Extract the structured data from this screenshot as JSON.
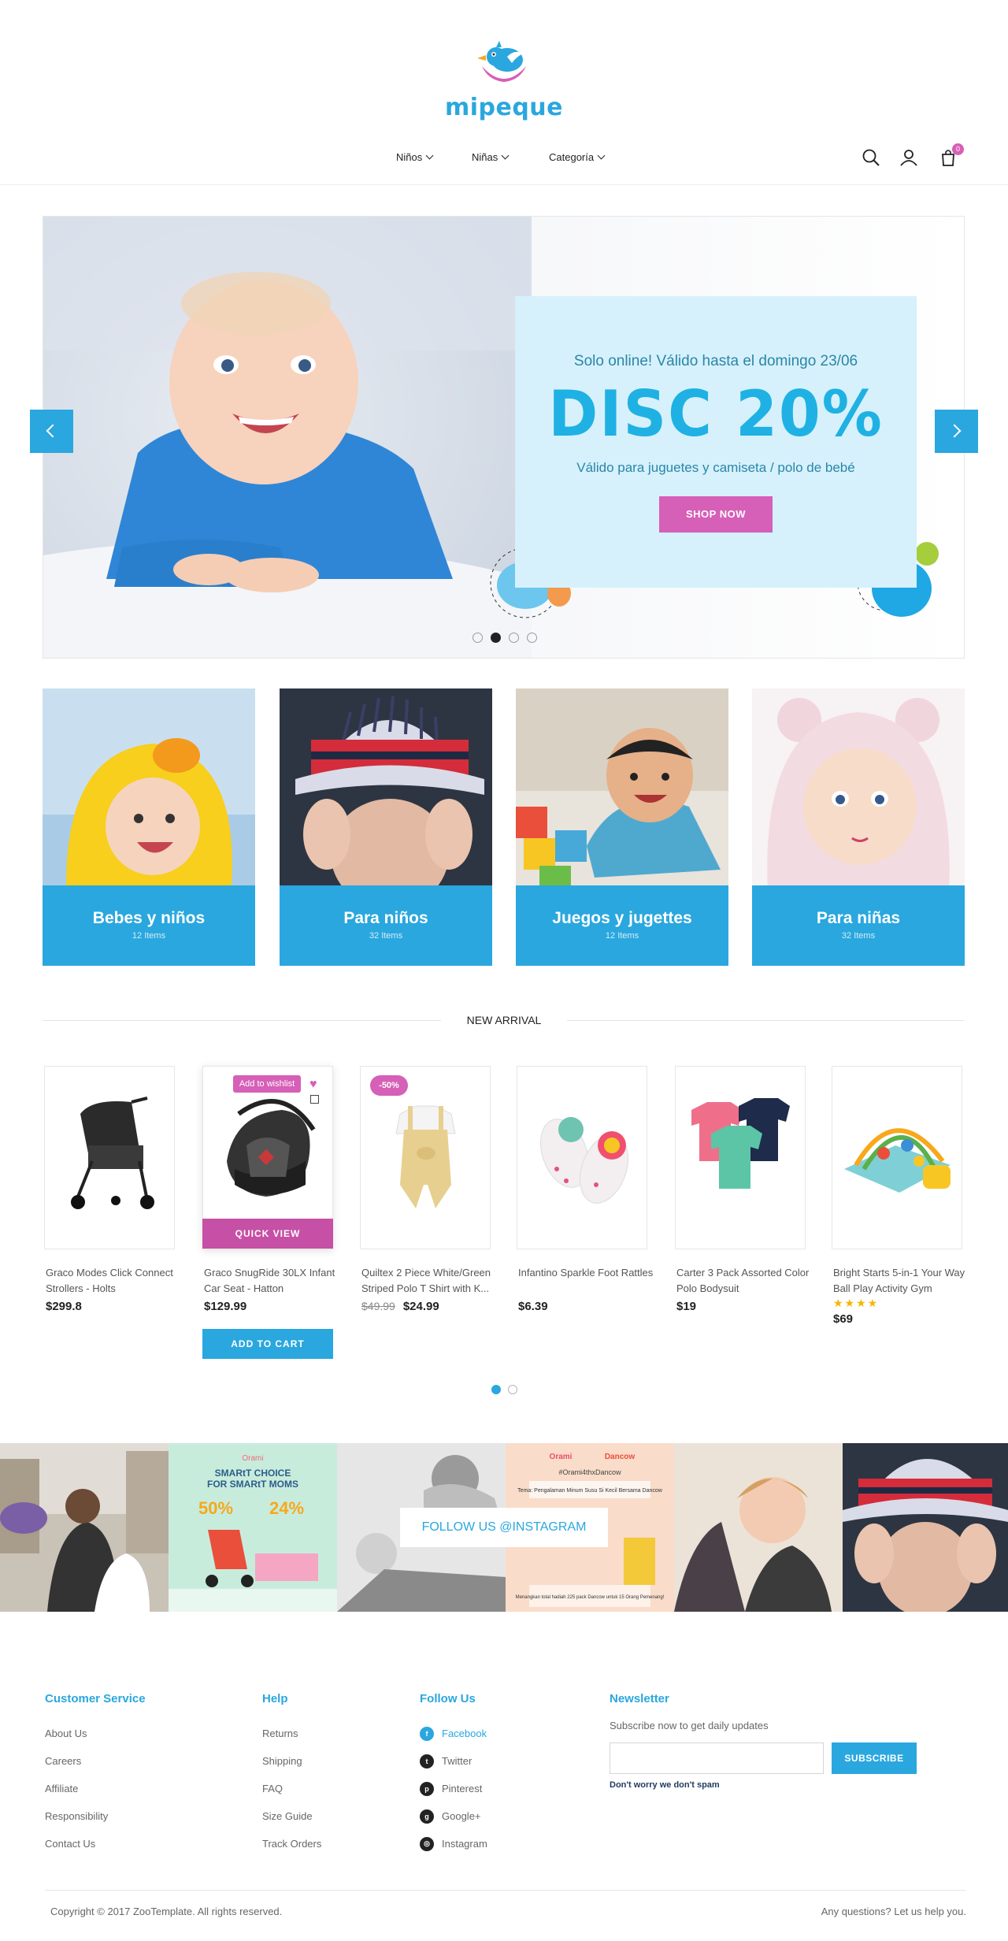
{
  "brand": {
    "name": "mipeque"
  },
  "nav": {
    "items": [
      {
        "label": "Niños"
      },
      {
        "label": "Niñas"
      },
      {
        "label": "Categoría"
      }
    ]
  },
  "cart": {
    "count": "0"
  },
  "hero": {
    "promo_top": "Solo online! Válido hasta el domingo 23/06",
    "promo_big": "DISC 20%",
    "promo_sub": "Válido para juguetes y camiseta / polo de bebé",
    "cta": "SHOP NOW"
  },
  "categories": [
    {
      "title": "Bebes y niños",
      "items": "12 Items"
    },
    {
      "title": "Para niños",
      "items": "32 Items"
    },
    {
      "title": "Juegos y jugettes",
      "items": "12 Items"
    },
    {
      "title": "Para niñas",
      "items": "32 Items"
    }
  ],
  "new_arrival": {
    "title": "NEW ARRIVAL",
    "wishlist_tip": "Add to wishlist",
    "quick_view": "QUICK VIEW",
    "add_to_cart": "ADD TO CART",
    "sale_badge": "-50%",
    "products": [
      {
        "name": "Graco Modes Click Connect Strollers - Holts",
        "price": "$299.8"
      },
      {
        "name": "Graco SnugRide 30LX Infant Car Seat - Hatton",
        "price": "$129.99"
      },
      {
        "name": "Quiltex 2 Piece White/Green Striped Polo T Shirt with K...",
        "old_price": "$49.99",
        "price": "$24.99"
      },
      {
        "name": "Infantino Sparkle Foot Rattles",
        "price": "$6.39"
      },
      {
        "name": "Carter 3 Pack Assorted Color Polo Bodysuit",
        "price": "$19"
      },
      {
        "name": "Bright Starts 5-in-1 Your Way Ball Play Activity Gym",
        "price": "$69",
        "rating": 4
      }
    ]
  },
  "instagram": {
    "follow_label": "FOLLOW US @INSTAGRAM",
    "ad1": {
      "brand": "Orami",
      "line1": "SMARtT CHOICE",
      "line2": "FOR SMARtT MOMS",
      "pct1": "50%",
      "pct2": "24%"
    },
    "ad2": {
      "brand": "Orami",
      "brand2": "Dancow",
      "line1": "#Orami4thxDancow",
      "line2": "Tema: Pengalaman Minum Susu Si Kecil Bersama Dancow",
      "line3": "Menangkan total hadiah 225 pack Dancow untuk 15 Orang Pemenang!"
    }
  },
  "footer": {
    "customer_service": {
      "title": "Customer Service",
      "links": [
        "About Us",
        "Careers",
        "Affiliate",
        "Responsibility",
        "Contact Us"
      ]
    },
    "help": {
      "title": "Help",
      "links": [
        "Returns",
        "Shipping",
        "FAQ",
        "Size Guide",
        "Track Orders"
      ]
    },
    "follow": {
      "title": "Follow Us",
      "links": [
        "Facebook",
        "Twitter",
        "Pinterest",
        "Google+",
        "Instagram"
      ]
    },
    "newsletter": {
      "title": "Newsletter",
      "subtitle": "Subscribe now to get daily updates",
      "button": "SUBSCRIBE",
      "note": "Don't worry we don't spam"
    },
    "copyright": "Copyright © 2017 ZooTemplate. All rights reserved.",
    "help_text": "Any questions? Let us help you."
  },
  "colors": {
    "primary": "#2aa7de",
    "accent": "#d65fb7",
    "promo_bg": "#d6f1fb"
  }
}
